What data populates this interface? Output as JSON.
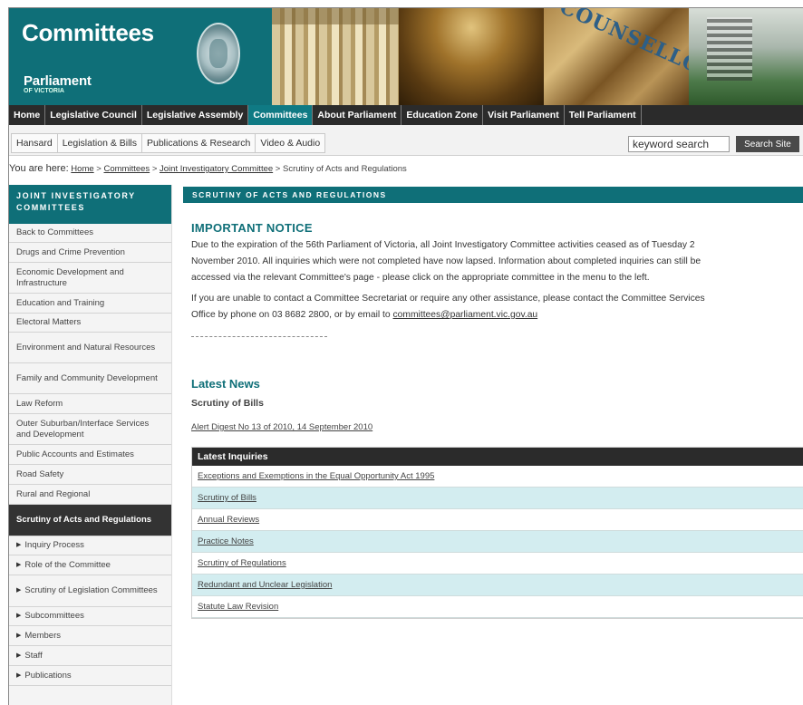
{
  "banner": {
    "title": "Committees",
    "parliament": "Parliament",
    "of_victoria": "OF VICTORIA",
    "photo_text": "COUNSELLORS"
  },
  "main_nav": [
    {
      "label": "Home",
      "active": false
    },
    {
      "label": "Legislative Council",
      "active": false
    },
    {
      "label": "Legislative Assembly",
      "active": false
    },
    {
      "label": "Committees",
      "active": true
    },
    {
      "label": "About Parliament",
      "active": false
    },
    {
      "label": "Education Zone",
      "active": false
    },
    {
      "label": "Visit Parliament",
      "active": false
    },
    {
      "label": "Tell Parliament",
      "active": false
    }
  ],
  "sub_nav": [
    "Hansard",
    "Legislation & Bills",
    "Publications & Research",
    "Video & Audio"
  ],
  "search": {
    "value": "keyword search",
    "button": "Search Site"
  },
  "breadcrumb": {
    "label": "You are here:",
    "items": [
      "Home",
      "Committees",
      "Joint Investigatory Committee"
    ],
    "current": "Scrutiny of Acts and Regulations",
    "sep": ">"
  },
  "sidebar": {
    "heading": "JOINT INVESTIGATORY COMMITTEES",
    "items": [
      {
        "label": "Back to Committees"
      },
      {
        "label": "Drugs and Crime Prevention"
      },
      {
        "label": "Economic Development and Infrastructure"
      },
      {
        "label": "Education and Training"
      },
      {
        "label": "Electoral Matters"
      },
      {
        "label": "Environment and Natural Resources"
      },
      {
        "label": "Family and Community Development"
      },
      {
        "label": "Law Reform"
      },
      {
        "label": "Outer Suburban/Interface Services and Development"
      },
      {
        "label": "Public Accounts and Estimates"
      },
      {
        "label": "Road Safety"
      },
      {
        "label": "Rural and Regional"
      },
      {
        "label": "Scrutiny of Acts and Regulations"
      }
    ],
    "subitems": [
      {
        "label": "Inquiry Process"
      },
      {
        "label": "Role of the Committee"
      },
      {
        "label": "Scrutiny of Legislation Committees"
      },
      {
        "label": "Subcommittees"
      },
      {
        "label": "Members"
      },
      {
        "label": "Staff"
      },
      {
        "label": "Publications"
      }
    ]
  },
  "content": {
    "section_title": "SCRUTINY OF ACTS AND REGULATIONS",
    "notice_title": "IMPORTANT NOTICE",
    "notice_line1": "Due to the expiration of the 56th Parliament of Victoria, all Joint Investigatory Committee activities ceased as of Tuesday 2",
    "notice_line2": "November 2010. All inquiries which were not completed have now lapsed. Information about completed inquiries can still be",
    "notice_line3": "accessed via the relevant Committee's page - please click on the appropriate committee in the menu to the left.",
    "contact_line1": "If you are unable to contact a Committee Secretariat or require any other assistance, please contact the Committee Services",
    "contact_line2": "Office by phone on 03 8682 2800, or by email to",
    "contact_email": "committees@parliament.vic.gov.au",
    "news_title": "Latest News",
    "news_subtitle": "Scrutiny of Bills",
    "news_link": "Alert Digest No 13 of 2010, 14 September 2010"
  },
  "inquiries": {
    "heading": "Latest Inquiries",
    "rows": [
      "Exceptions and Exemptions in the Equal Opportunity Act 1995",
      "Scrutiny of Bills",
      "Annual Reviews",
      "Practice Notes",
      "Scrutiny of Regulations",
      "Redundant and Unclear Legislation",
      "Statute Law Revision"
    ]
  },
  "colors": {
    "accent": "#0f6f78",
    "nav_bg": "#2b2b2b",
    "row_alt": "#d3edf0"
  }
}
